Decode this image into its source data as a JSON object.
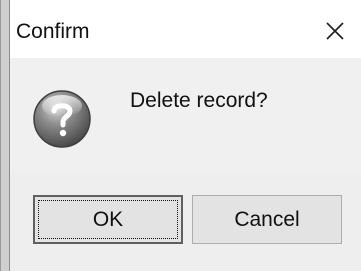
{
  "dialog": {
    "title": "Confirm",
    "message": "Delete record?",
    "icon": "question-icon",
    "buttons": {
      "ok_label": "OK",
      "cancel_label": "Cancel"
    }
  },
  "colors": {
    "titlebar_bg": "#ffffff",
    "content_bg": "#f0f0f0",
    "button_bg": "#e3e3e3",
    "text": "#111111"
  }
}
